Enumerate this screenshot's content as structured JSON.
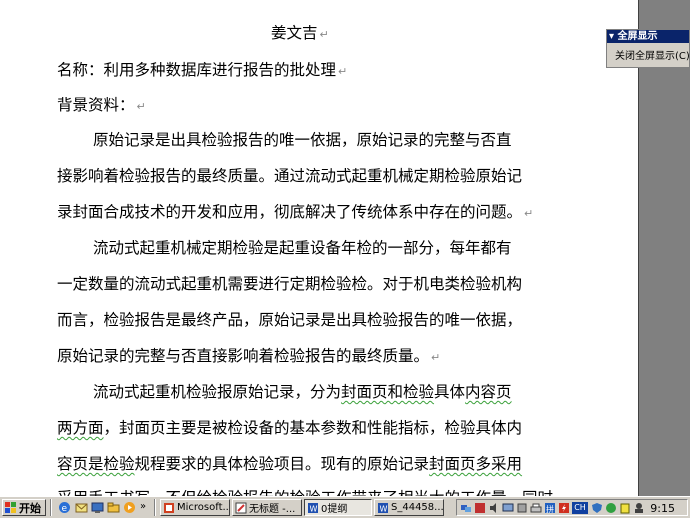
{
  "document": {
    "title": "姜文吉",
    "name_line": "名称：利用多种数据库进行报告的批处理",
    "background_label": "背景资料：",
    "para1": [
      "原始记录是出具检验报告的唯一依据，原始记录的完整与否直",
      "接影响着检验报告的最终质量。通过流动式起重机械定期检验原始记",
      "录封面合成技术的开发和应用，彻底解决了传统体系中存在的问题。"
    ],
    "para2": [
      "流动式起重机械定期检验是起重设备年检的一部分，每年都有",
      "一定数量的流动式起重机需要进行定期检验检。对于机电类检验机构",
      "而言，检验报告是最终产品，原始记录是出具检验报告的唯一依据，",
      "原始记录的完整与否直接影响着检验报告的最终质量。"
    ],
    "para3": {
      "l1_a": "流动式起重机检验报原始记录，分为",
      "l1_b": "封面页和检验",
      "l1_c": "具体",
      "l1_d": "内容页",
      "l2_a": "两方面",
      "l2_b": "，封面页主要是被检设备的基本参数和性能指标，检验具体内",
      "l3_a": "容页是检验",
      "l3_b": "规程要求的具体检验项目。现有的原始记录",
      "l3_c": "封面页多采用",
      "l4_partial": "采用手工书写，不但给检验报告的检验工作带来了相当大的工作量，同时"
    },
    "paragraph_mark": "↵"
  },
  "fullscreen_toolbar": {
    "title": "全屏显示",
    "close_label": "关闭全屏显示(C)"
  },
  "taskbar": {
    "start_label": "开始",
    "buttons": [
      {
        "label": "Microsoft..."
      },
      {
        "label": "无标题 -..."
      },
      {
        "label": "0提纲"
      },
      {
        "label": "S_44458..."
      }
    ],
    "tray": {
      "ch_label": "CH",
      "clock": "9:15"
    }
  },
  "colors": {
    "title_bar": "#0a246a",
    "taskbar": "#d4d0c8",
    "side_panel": "#808080",
    "spell_underline": "#3aa03a"
  }
}
